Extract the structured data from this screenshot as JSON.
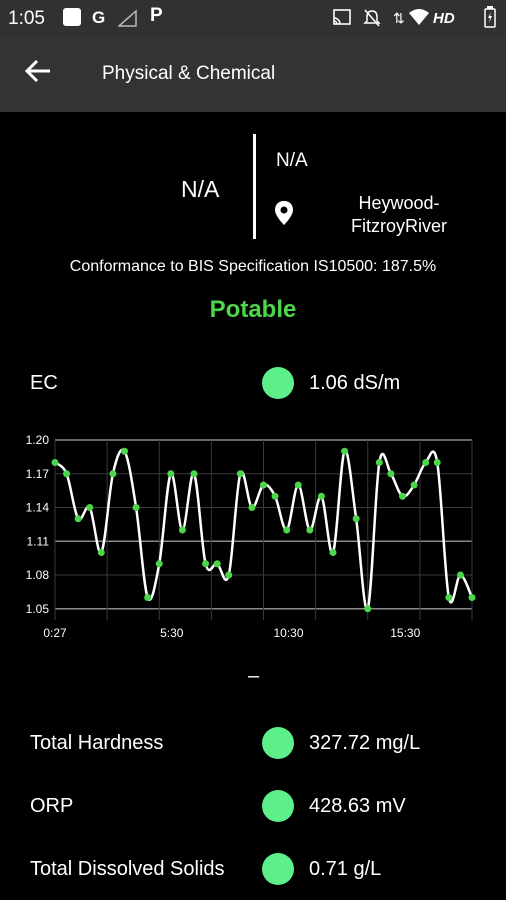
{
  "status_bar": {
    "time": "1:05",
    "icons": [
      "square-icon",
      "google-icon",
      "signal-icon",
      "parking-icon",
      "cast-icon",
      "mute-icon",
      "data-icon",
      "wifi-icon",
      "hd-icon",
      "battery-icon"
    ],
    "hd_text": "HD"
  },
  "appbar": {
    "title": "Physical & Chemical"
  },
  "station": {
    "value_left": "N/A",
    "value_right": "N/A",
    "location_line1": "Heywood-",
    "location_line2": "FitzroyRiver"
  },
  "conformance_text": "Conformance to BIS Specification IS10500: 187.5%",
  "status": "Potable",
  "colors": {
    "accent_green": "#4cd64c",
    "dot_green": "#5df08a",
    "appbar": "#333333",
    "statusbar": "#313131"
  },
  "ec": {
    "label": "EC",
    "value": "1.06 dS/m"
  },
  "separator": "–",
  "params": [
    {
      "label": "Total Hardness",
      "value": "327.72 mg/L"
    },
    {
      "label": "ORP",
      "value": "428.63 mV"
    },
    {
      "label": "Total Dissolved Solids",
      "value": "0.71 g/L"
    }
  ],
  "chart_data": {
    "type": "line",
    "title": "",
    "xlabel": "",
    "ylabel": "",
    "ylim": [
      1.04,
      1.2
    ],
    "y_ticks": [
      "1.20",
      "1.17",
      "1.14",
      "1.11",
      "1.08",
      "1.05"
    ],
    "y_tick_values": [
      1.2,
      1.17,
      1.14,
      1.11,
      1.08,
      1.05
    ],
    "x_tick_labels": [
      "0:27",
      "5:30",
      "10:30",
      "15:30"
    ],
    "series": [
      {
        "color": "#ffffff",
        "marker_color": "#4cd64c",
        "values": [
          1.18,
          1.17,
          1.13,
          1.14,
          1.1,
          1.17,
          1.19,
          1.14,
          1.06,
          1.09,
          1.17,
          1.12,
          1.17,
          1.09,
          1.09,
          1.08,
          1.17,
          1.14,
          1.16,
          1.15,
          1.12,
          1.16,
          1.12,
          1.15,
          1.1,
          1.19,
          1.13,
          1.05,
          1.18,
          1.17,
          1.15,
          1.16,
          1.18,
          1.18,
          1.06,
          1.08,
          1.06
        ]
      }
    ],
    "grid": true
  }
}
